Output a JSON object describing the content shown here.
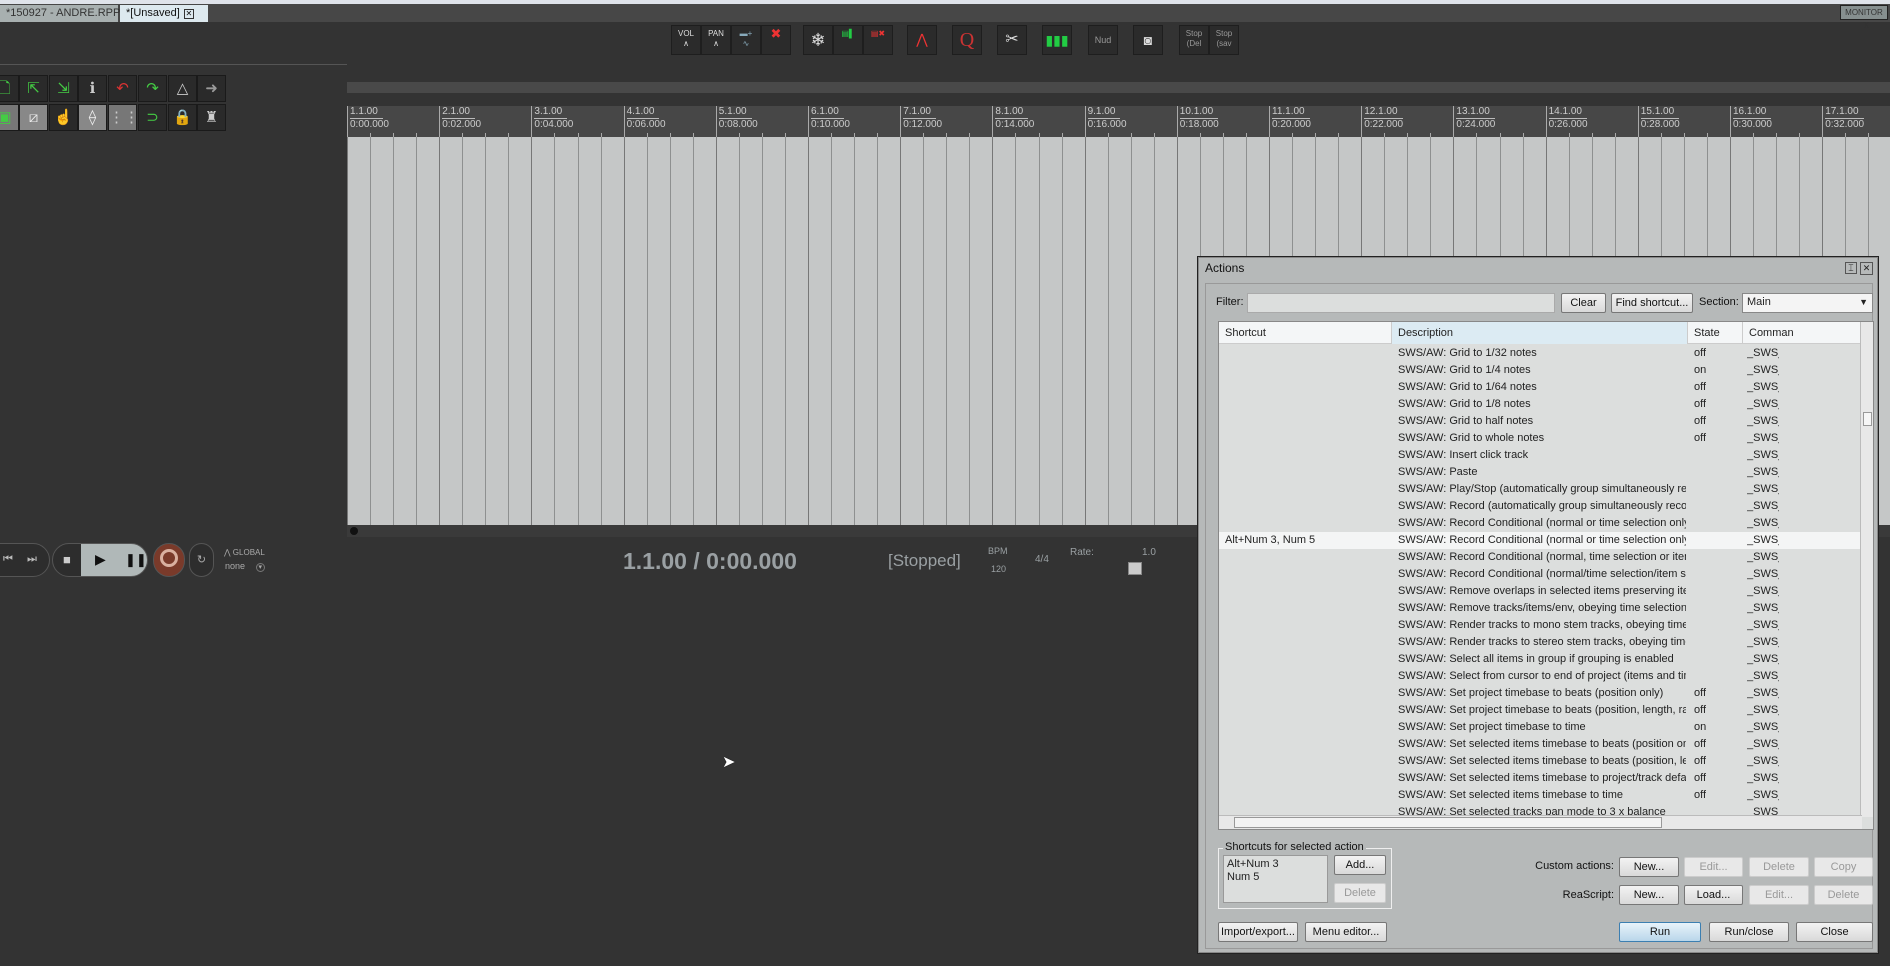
{
  "tabs": [
    {
      "label": "*150927 - ANDRE.RPP"
    },
    {
      "label": "*[Unsaved]"
    }
  ],
  "monitor_fx": "MONITOR FX",
  "toolbar": {
    "vol": "VOL",
    "pan": "PAN",
    "nud": "Nud",
    "stop_del": "Stop (Del",
    "stop_sav": "Stop (sav"
  },
  "ruler": {
    "bars": [
      "1.1.00",
      "2.1.00",
      "3.1.00",
      "4.1.00",
      "5.1.00",
      "6.1.00",
      "7.1.00",
      "8.1.00",
      "9.1.00",
      "10.1.00",
      "11.1.00",
      "12.1.00",
      "13.1.00",
      "14.1.00",
      "15.1.00",
      "16.1.00",
      "17.1.00"
    ],
    "times": [
      "0:00.000",
      "0:02.000",
      "0:04.000",
      "0:06.000",
      "0:08.000",
      "0:10.000",
      "0:12.000",
      "0:14.000",
      "0:16.000",
      "0:18.000",
      "0:20.000",
      "0:22.000",
      "0:24.000",
      "0:26.000",
      "0:28.000",
      "0:30.000",
      "0:32.000"
    ]
  },
  "transport": {
    "automation_mode": "GLOBAL",
    "automation_value": "none",
    "position": "1.1.00 / 0:00.000",
    "status": "[Stopped]",
    "bpm_label": "BPM",
    "bpm": "120",
    "time_sig": "4/4",
    "rate_label": "Rate:",
    "rate": "1.0"
  },
  "actions": {
    "title": "Actions",
    "filter_label": "Filter:",
    "filter_value": "",
    "clear": "Clear",
    "find_shortcut": "Find shortcut...",
    "section_label": "Section:",
    "section_value": "Main",
    "columns": [
      "Shortcut",
      "Description",
      "State",
      "Comman"
    ],
    "rows": [
      {
        "shortcut": "",
        "description": "SWS/AW: Grid to 1/32 notes",
        "state": "off",
        "command": "_SWS_A"
      },
      {
        "shortcut": "",
        "description": "SWS/AW: Grid to 1/4 notes",
        "state": "on",
        "command": "_SWS_A"
      },
      {
        "shortcut": "",
        "description": "SWS/AW: Grid to 1/64 notes",
        "state": "off",
        "command": "_SWS_A"
      },
      {
        "shortcut": "",
        "description": "SWS/AW: Grid to 1/8 notes",
        "state": "off",
        "command": "_SWS_A"
      },
      {
        "shortcut": "",
        "description": "SWS/AW: Grid to half notes",
        "state": "off",
        "command": "_SWS_A"
      },
      {
        "shortcut": "",
        "description": "SWS/AW: Grid to whole notes",
        "state": "off",
        "command": "_SWS_A"
      },
      {
        "shortcut": "",
        "description": "SWS/AW: Insert click track",
        "state": "",
        "command": "_SWS_A"
      },
      {
        "shortcut": "",
        "description": "SWS/AW: Paste",
        "state": "",
        "command": "_SWS_A"
      },
      {
        "shortcut": "",
        "description": "SWS/AW: Play/Stop (automatically group simultaneously recorded ite...",
        "state": "",
        "command": "_SWS_A"
      },
      {
        "shortcut": "",
        "description": "SWS/AW: Record (automatically group simultaneously recorded items)",
        "state": "",
        "command": "_SWS_A"
      },
      {
        "shortcut": "",
        "description": "SWS/AW: Record Conditional (normal or time selection only)",
        "state": "",
        "command": "_SWS_A"
      },
      {
        "shortcut": "Alt+Num 3, Num 5",
        "description": "SWS/AW: Record Conditional (normal or time selection only, automatic...",
        "state": "",
        "command": "_SWS_A",
        "selected": true
      },
      {
        "shortcut": "",
        "description": "SWS/AW: Record Conditional (normal, time selection or item selection)",
        "state": "",
        "command": "_SWS_A"
      },
      {
        "shortcut": "",
        "description": "SWS/AW: Record Conditional (normal/time selection/item selection, a...",
        "state": "",
        "command": "_SWS_A"
      },
      {
        "shortcut": "",
        "description": "SWS/AW: Remove overlaps in selected items preserving item starts",
        "state": "",
        "command": "_SWS_A"
      },
      {
        "shortcut": "",
        "description": "SWS/AW: Remove tracks/items/env, obeying time selection and leavi...",
        "state": "",
        "command": "_SWS_A"
      },
      {
        "shortcut": "",
        "description": "SWS/AW: Render tracks to mono stem tracks, obeying time selection",
        "state": "",
        "command": "_SWS_A"
      },
      {
        "shortcut": "",
        "description": "SWS/AW: Render tracks to stereo stem tracks, obeying time selection",
        "state": "",
        "command": "_SWS_A"
      },
      {
        "shortcut": "",
        "description": "SWS/AW: Select all items in group if grouping is enabled",
        "state": "",
        "command": "_SWS_A"
      },
      {
        "shortcut": "",
        "description": "SWS/AW: Select from cursor to end of project (items and time selection)",
        "state": "",
        "command": "_SWS_A"
      },
      {
        "shortcut": "",
        "description": "SWS/AW: Set project timebase to beats (position only)",
        "state": "off",
        "command": "_SWS_A"
      },
      {
        "shortcut": "",
        "description": "SWS/AW: Set project timebase to beats (position, length, rate)",
        "state": "off",
        "command": "_SWS_A"
      },
      {
        "shortcut": "",
        "description": "SWS/AW: Set project timebase to time",
        "state": "on",
        "command": "_SWS_A"
      },
      {
        "shortcut": "",
        "description": "SWS/AW: Set selected items timebase to beats (position only)",
        "state": "off",
        "command": "_SWS_A"
      },
      {
        "shortcut": "",
        "description": "SWS/AW: Set selected items timebase to beats (position, length, rate)",
        "state": "off",
        "command": "_SWS_A"
      },
      {
        "shortcut": "",
        "description": "SWS/AW: Set selected items timebase to project/track default",
        "state": "off",
        "command": "_SWS_A"
      },
      {
        "shortcut": "",
        "description": "SWS/AW: Set selected items timebase to time",
        "state": "off",
        "command": "_SWS_A"
      },
      {
        "shortcut": "",
        "description": "SWS/AW: Set selected tracks pan mode to 3 x balance",
        "state": "",
        "command": "_SWS_A"
      }
    ],
    "shortcuts_group": "Shortcuts for selected action",
    "shortcuts": [
      "Alt+Num 3",
      "Num 5"
    ],
    "add": "Add...",
    "delete": "Delete",
    "custom_actions_label": "Custom actions:",
    "reascript_label": "ReaScript:",
    "new": "New...",
    "edit": "Edit...",
    "copy": "Copy",
    "load": "Load...",
    "import_export": "Import/export...",
    "menu_editor": "Menu editor...",
    "run": "Run",
    "run_close": "Run/close",
    "close": "Close"
  }
}
